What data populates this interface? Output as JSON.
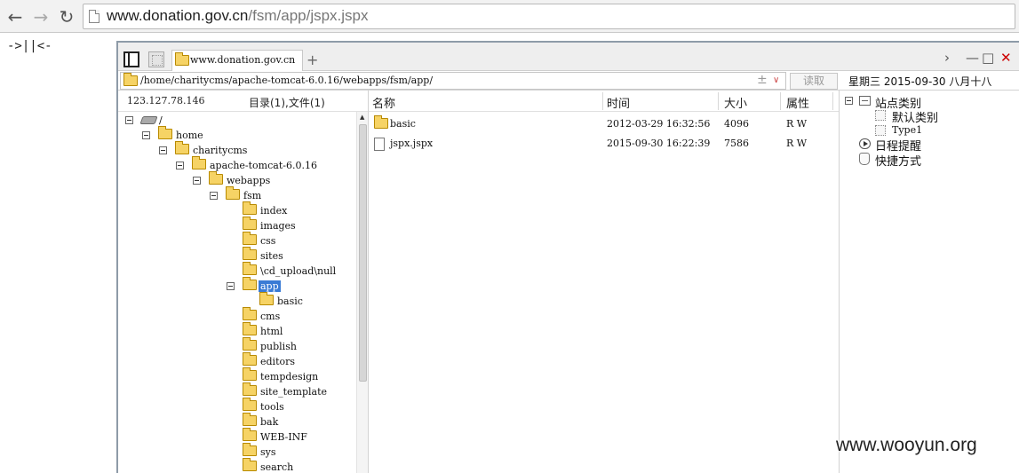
{
  "browser": {
    "url_host": "www.donation.gov.cn",
    "url_path": "/fsm/app/jspx.jspx",
    "back_icon": "back-arrow-icon",
    "forward_icon": "forward-arrow-icon",
    "reload_icon": "reload-icon"
  },
  "marker_text": "->||<-",
  "fm": {
    "tab_label": "www.donation.gov.cn",
    "tab_add": "+",
    "path": "/home/charitycms/apache-tomcat-6.0.16/webapps/fsm/app/",
    "path_plus": "±",
    "path_dropdown": "∨",
    "read_button": "读取",
    "date_line": "星期三 2015-09-30 八月十八",
    "ip": "123.127.78.146",
    "counts": "目录(1),文件(1)",
    "tree": [
      {
        "label": "/",
        "level": 0,
        "toggle": true,
        "icon": "drive"
      },
      {
        "label": "home",
        "level": 1,
        "toggle": true
      },
      {
        "label": "charitycms",
        "level": 2,
        "toggle": true
      },
      {
        "label": "apache-tomcat-6.0.16",
        "level": 3,
        "toggle": true
      },
      {
        "label": "webapps",
        "level": 4,
        "toggle": true
      },
      {
        "label": "fsm",
        "level": 5,
        "toggle": true
      },
      {
        "label": "index",
        "level": 6,
        "toggle": false
      },
      {
        "label": "images",
        "level": 6,
        "toggle": false
      },
      {
        "label": "css",
        "level": 6,
        "toggle": false
      },
      {
        "label": "sites",
        "level": 6,
        "toggle": false
      },
      {
        "label": "\\cd_upload\\null",
        "level": 6,
        "toggle": false
      },
      {
        "label": "app",
        "level": 6,
        "toggle": true,
        "selected": true
      },
      {
        "label": "basic",
        "level": 7,
        "toggle": false
      },
      {
        "label": "cms",
        "level": 6,
        "toggle": false
      },
      {
        "label": "html",
        "level": 6,
        "toggle": false
      },
      {
        "label": "publish",
        "level": 6,
        "toggle": false
      },
      {
        "label": "editors",
        "level": 6,
        "toggle": false
      },
      {
        "label": "tempdesign",
        "level": 6,
        "toggle": false
      },
      {
        "label": "site_template",
        "level": 6,
        "toggle": false
      },
      {
        "label": "tools",
        "level": 6,
        "toggle": false
      },
      {
        "label": "bak",
        "level": 6,
        "toggle": false
      },
      {
        "label": "WEB-INF",
        "level": 6,
        "toggle": false
      },
      {
        "label": "sys",
        "level": 6,
        "toggle": false
      },
      {
        "label": "search",
        "level": 6,
        "toggle": false
      }
    ],
    "columns": {
      "name": "名称",
      "time": "时间",
      "size": "大小",
      "attr": "属性"
    },
    "files": [
      {
        "name": "basic",
        "time": "2012-03-29 16:32:56",
        "size": "4096",
        "attr": "R W",
        "type": "folder"
      },
      {
        "name": "jspx.jspx",
        "time": "2015-09-30 16:22:39",
        "size": "7586",
        "attr": "R W",
        "type": "file"
      }
    ],
    "right": {
      "root": "站点类别",
      "cat1": "默认类别",
      "cat2": "Type1",
      "schedule": "日程提醒",
      "shortcut": "快捷方式"
    }
  },
  "watermark": "www.wooyun.org",
  "colors": {
    "selection": "#3a7bd5",
    "folder": "#f6d365",
    "window_border": "#8e9ba8"
  }
}
